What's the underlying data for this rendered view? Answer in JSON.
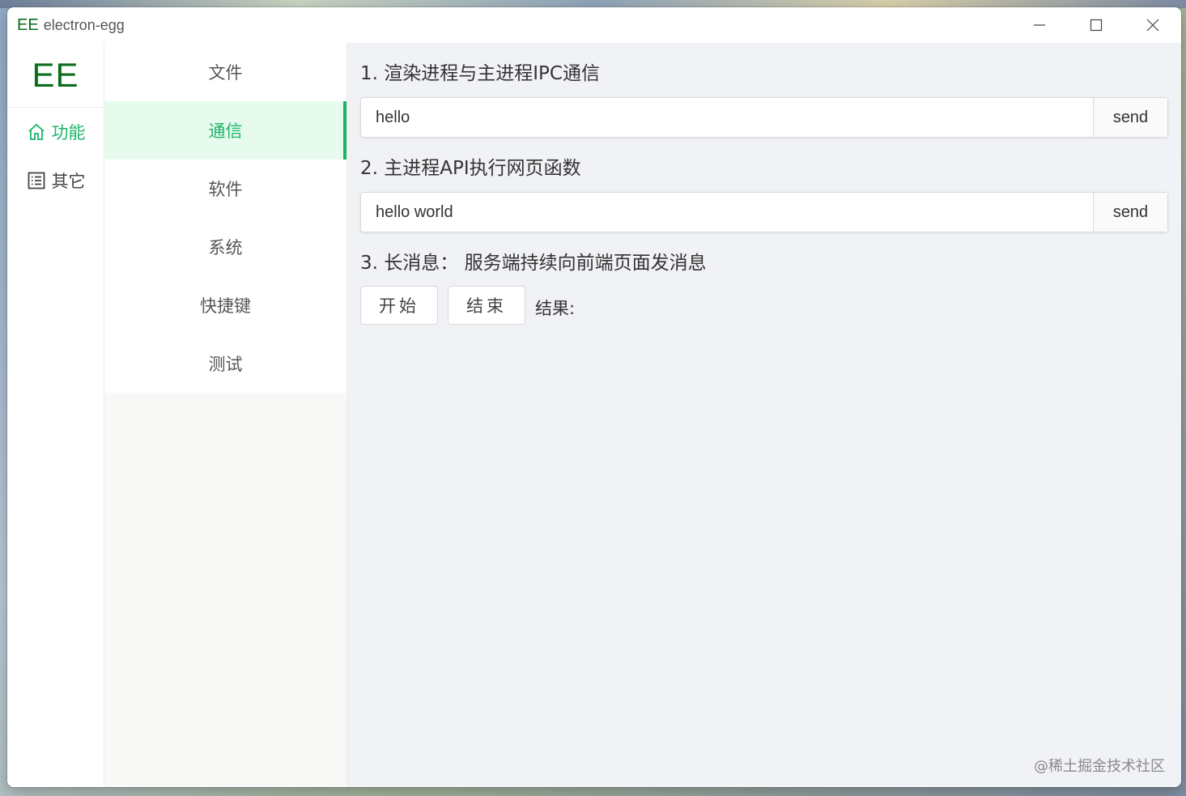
{
  "window": {
    "logo": "EE",
    "title": "electron-egg",
    "controls": [
      "minimize-icon",
      "maximize-icon",
      "close-icon"
    ]
  },
  "sidebar": {
    "logo": "EE",
    "items": [
      {
        "label": "功能",
        "icon": "home-icon",
        "active": true
      },
      {
        "label": "其它",
        "icon": "list-icon",
        "active": false
      }
    ]
  },
  "submenu": {
    "items": [
      {
        "label": "文件",
        "active": false
      },
      {
        "label": "通信",
        "active": true
      },
      {
        "label": "软件",
        "active": false
      },
      {
        "label": "系统",
        "active": false
      },
      {
        "label": "快捷键",
        "active": false
      },
      {
        "label": "测试",
        "active": false
      }
    ]
  },
  "main": {
    "section1": {
      "title": "1. 渲染进程与主进程IPC通信",
      "input_value": "hello",
      "button": "send"
    },
    "section2": {
      "title": "2. 主进程API执行网页函数",
      "input_value": "hello world",
      "button": "send"
    },
    "section3": {
      "title": "3. 长消息： 服务端持续向前端页面发消息",
      "start_button": "开始",
      "end_button": "结束",
      "result_label": "结果:"
    }
  },
  "watermark": "@稀土掘金技术社区",
  "colors": {
    "accent": "#1bb56a",
    "logo": "#0b6b1e",
    "content_bg": "#f0f2f5"
  }
}
